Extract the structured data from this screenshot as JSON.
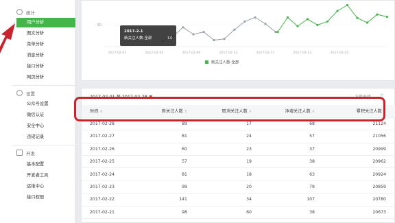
{
  "sidebar": {
    "sections": [
      {
        "title": "统计",
        "icon": "stats-icon",
        "items": [
          "用户分析",
          "图文分析",
          "菜单分析",
          "消息分析",
          "接口分析",
          "网页分析"
        ],
        "active_index": 0
      },
      {
        "title": "设置",
        "icon": "gear-icon",
        "items": [
          "公众号设置",
          "微信认证",
          "安全中心",
          "违规记录"
        ]
      },
      {
        "title": "开发",
        "icon": "dev-icon",
        "items": [
          "基本配置",
          "开发者工具",
          "运维中心",
          "接口权限"
        ]
      }
    ]
  },
  "chart": {
    "legend": "新关注人数-全部",
    "y_tick": "50",
    "x_ticks": [
      "2017-02-01",
      "2017-02-05",
      "2017-02-09",
      "2017-02-13",
      "2017-02-17",
      "2017-02-21",
      "2017-02-25"
    ],
    "tooltip": {
      "date": "2017-2-1",
      "label": "新关注人数-全部",
      "value": "14"
    },
    "series_gray": [
      58,
      66,
      82,
      70,
      74,
      60,
      62,
      78,
      92,
      99,
      88,
      74
    ],
    "series_green": [
      74,
      99,
      84,
      96,
      86,
      92,
      110,
      120,
      98,
      90,
      104,
      100
    ]
  },
  "table": {
    "date_range": "2017-02-01 至 2017-02-28",
    "export": "下载表格",
    "close": "×",
    "headers": [
      "时间",
      "新关注人数",
      "取消关注人数",
      "净增关注人数",
      "累积关注人数"
    ],
    "rows": [
      [
        "2017-02-28",
        "89",
        "17",
        "68",
        "21124"
      ],
      [
        "2017-02-27",
        "81",
        "24",
        "57",
        "21056"
      ],
      [
        "2017-02-26",
        "60",
        "23",
        "37",
        "20999"
      ],
      [
        "2017-02-25",
        "57",
        "19",
        "38",
        "20962"
      ],
      [
        "2017-02-24",
        "81",
        "18",
        "63",
        "20924"
      ],
      [
        "2017-02-23",
        "99",
        "20",
        "79",
        "20859"
      ],
      [
        "2017-02-22",
        "141",
        "34",
        "107",
        "20780"
      ],
      [
        "2017-02-21",
        "98",
        "60",
        "38",
        "20673"
      ]
    ]
  },
  "colors": {
    "accent_green": "#44b549",
    "highlight_red": "#c9232e",
    "line_gray": "#9aa0a6"
  }
}
